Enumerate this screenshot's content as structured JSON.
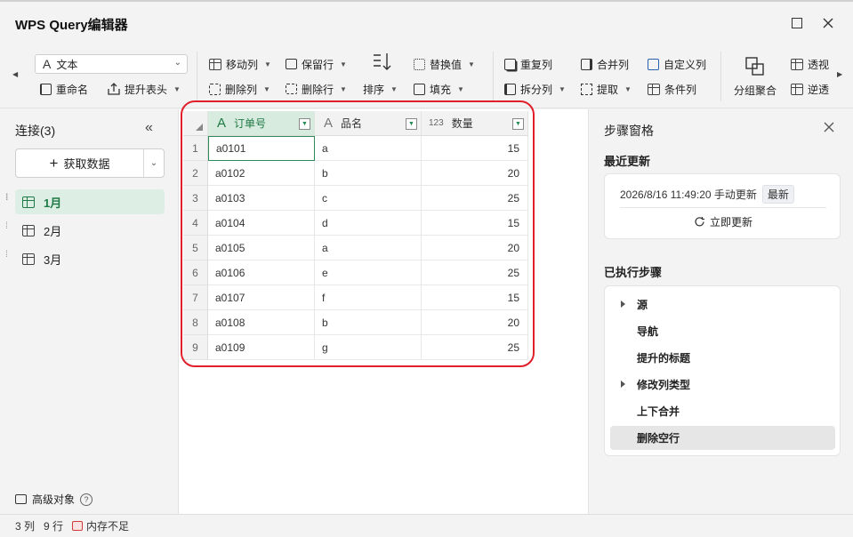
{
  "window": {
    "title": "WPS Query编辑器"
  },
  "ribbon": {
    "type_select": "文本",
    "rename": "重命名",
    "promote_header": "提升表头",
    "move_column": "移动列",
    "remove_column": "删除列",
    "keep_rows": "保留行",
    "remove_rows": "删除行",
    "sort": "排序",
    "replace_values": "替换值",
    "fill": "填充",
    "duplicate_column": "重复列",
    "split_column": "拆分列",
    "merge_columns": "合并列",
    "extract": "提取",
    "custom_column": "自定义列",
    "conditional_column": "条件列",
    "group_by": "分组聚合",
    "pivot": "透视",
    "unpivot": "逆透"
  },
  "left": {
    "title": "连接(3)",
    "get_data": "获取数据",
    "queries": [
      "1月",
      "2月",
      "3月"
    ],
    "advanced": "高级对象"
  },
  "table": {
    "columns": [
      {
        "type_icon": "A",
        "name": "订单号"
      },
      {
        "type_icon": "A",
        "name": "品名"
      },
      {
        "type_icon": "123",
        "name": "数量"
      }
    ],
    "rows": [
      [
        "1",
        "a0101",
        "a",
        "15"
      ],
      [
        "2",
        "a0102",
        "b",
        "20"
      ],
      [
        "3",
        "a0103",
        "c",
        "25"
      ],
      [
        "4",
        "a0104",
        "d",
        "15"
      ],
      [
        "5",
        "a0105",
        "a",
        "20"
      ],
      [
        "6",
        "a0106",
        "e",
        "25"
      ],
      [
        "7",
        "a0107",
        "f",
        "15"
      ],
      [
        "8",
        "a0108",
        "b",
        "20"
      ],
      [
        "9",
        "a0109",
        "g",
        "25"
      ]
    ]
  },
  "right": {
    "title": "步骤窗格",
    "recent_title": "最近更新",
    "recent_time": "2026/8/16 11:49:20 手动更新",
    "latest_badge": "最新",
    "update_now": "立即更新",
    "steps_title": "已执行步骤",
    "steps": [
      "源",
      "导航",
      "提升的标题",
      "修改列类型",
      "上下合并",
      "删除空行"
    ]
  },
  "status": {
    "columns": "3 列",
    "rows": "9 行",
    "memory": "内存不足"
  },
  "colors": {
    "accent": "#1f7a45",
    "highlight_border": "#e01f2a"
  }
}
